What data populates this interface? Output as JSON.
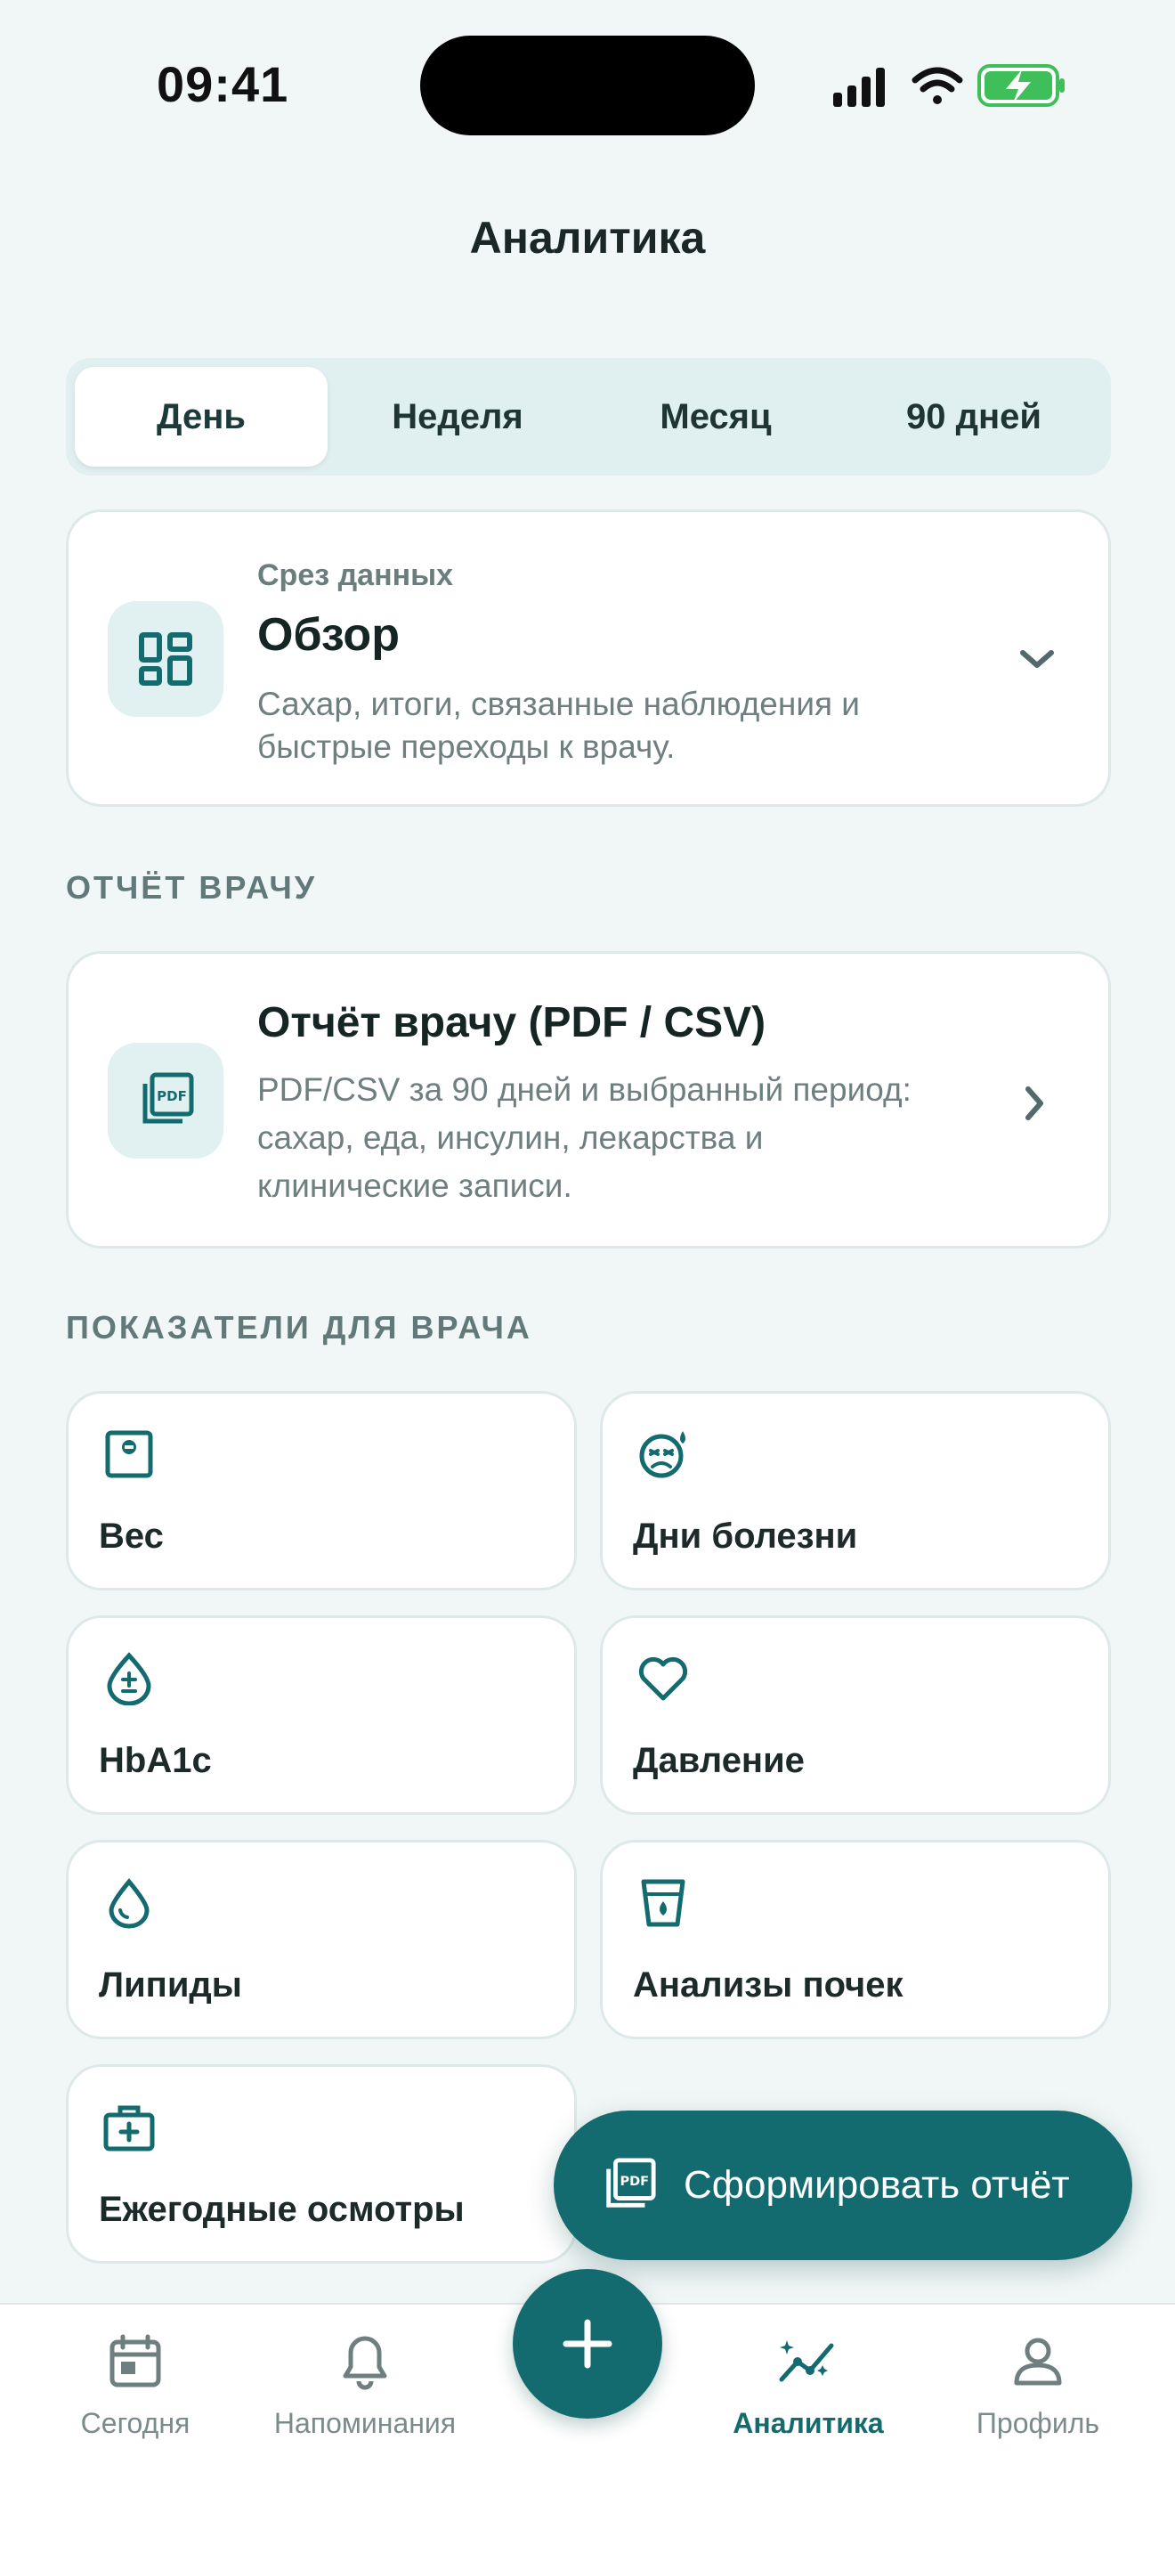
{
  "status": {
    "time": "09:41"
  },
  "header": {
    "title": "Аналитика"
  },
  "segments": [
    {
      "label": "День",
      "active": true
    },
    {
      "label": "Неделя",
      "active": false
    },
    {
      "label": "Месяц",
      "active": false
    },
    {
      "label": "90 дней",
      "active": false
    }
  ],
  "slice": {
    "eyebrow": "Срез данных",
    "title": "Обзор",
    "description_line1": "Сахар, итоги, связанные наблюдения и",
    "description_line2": "быстрые переходы к врачу.",
    "icon": "dashboard-icon"
  },
  "report_section": {
    "label": "ОТЧЁТ ВРАЧУ",
    "title": "Отчёт врачу (PDF / CSV)",
    "description_line1": "PDF/CSV за 90 дней и выбранный период:",
    "description_line2": "сахар, еда, инсулин, лекарства и",
    "description_line3": "клинические записи.",
    "icon": "pdf-icon"
  },
  "metrics_section": {
    "label": "ПОКАЗАТЕЛИ ДЛЯ ВРАЧА",
    "items": [
      {
        "label": "Вес",
        "icon": "scale-icon"
      },
      {
        "label": "Дни болезни",
        "icon": "sick-face-icon"
      },
      {
        "label": "HbA1c",
        "icon": "blood-drop-plus-minus-icon"
      },
      {
        "label": "Давление",
        "icon": "heart-icon"
      },
      {
        "label": "Липиды",
        "icon": "drop-icon"
      },
      {
        "label": "Анализы почек",
        "icon": "lab-cup-icon"
      },
      {
        "label": "Ежегодные осмотры",
        "icon": "medical-kit-icon"
      }
    ]
  },
  "fab": {
    "label": "Сформировать отчёт",
    "icon": "pdf-icon"
  },
  "tabbar": {
    "items": [
      {
        "label": "Сегодня",
        "icon": "calendar-icon",
        "active": false
      },
      {
        "label": "Напоминания",
        "icon": "bell-icon",
        "active": false
      },
      {
        "label": "Аналитика",
        "icon": "analytics-icon",
        "active": true
      },
      {
        "label": "Профиль",
        "icon": "profile-icon",
        "active": false
      }
    ],
    "add_icon": "plus-icon"
  },
  "colors": {
    "accent": "#136b6f",
    "background": "#f1f7f7",
    "icon_tile": "#e1f0f0",
    "muted_text": "#6f7f80"
  }
}
